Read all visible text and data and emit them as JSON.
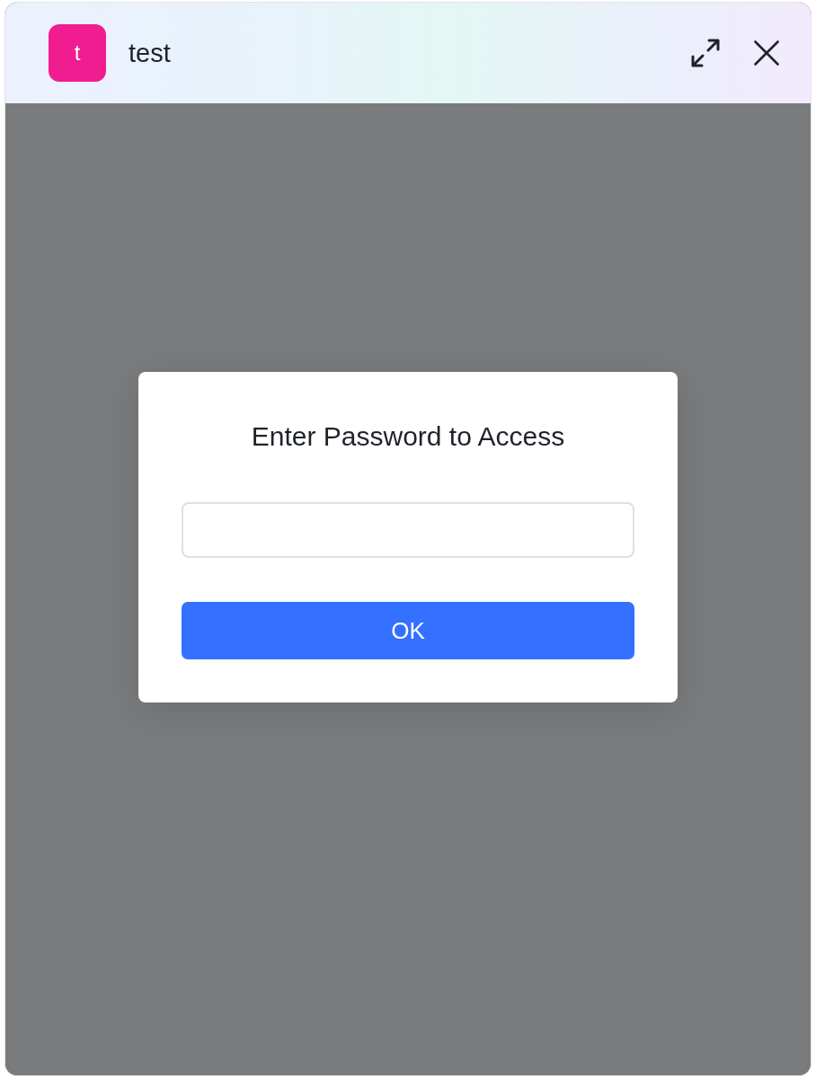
{
  "window": {
    "avatar_letter": "t",
    "title": "test",
    "controls": [
      {
        "kind": "expand"
      },
      {
        "kind": "close"
      }
    ]
  },
  "dialog": {
    "title": "Enter Password to Access",
    "password_field": {
      "kind": "password"
    },
    "button": {
      "label": "OK"
    }
  }
}
